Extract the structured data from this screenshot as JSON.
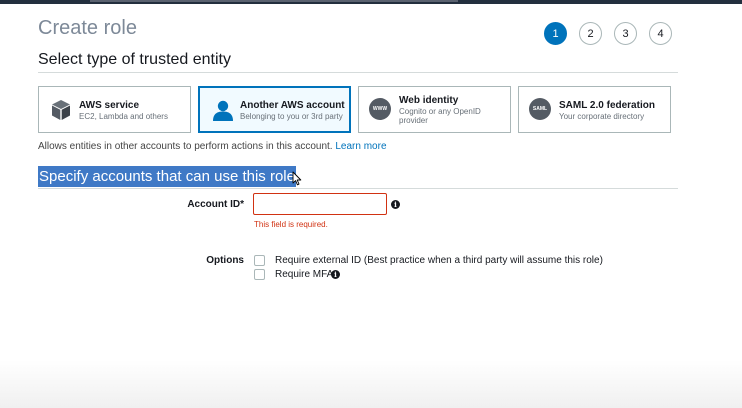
{
  "header": {
    "title": "Create role",
    "steps": [
      "1",
      "2",
      "3",
      "4"
    ],
    "active_step": 1
  },
  "trusted_entity": {
    "heading": "Select type of trusted entity",
    "options": [
      {
        "title": "AWS service",
        "subtitle": "EC2, Lambda and others",
        "icon": "aws-service-cube-icon",
        "selected": false
      },
      {
        "title": "Another AWS account",
        "subtitle": "Belonging to you or 3rd party",
        "icon": "user-account-icon",
        "selected": true
      },
      {
        "title": "Web identity",
        "subtitle": "Cognito or any OpenID provider",
        "icon": "web-identity-icon",
        "icon_text": "WWW",
        "selected": false
      },
      {
        "title": "SAML 2.0 federation",
        "subtitle": "Your corporate directory",
        "icon": "saml-federation-icon",
        "icon_text": "SAML",
        "selected": false
      }
    ],
    "help_text": "Allows entities in other accounts to perform actions in this account.",
    "learn_more": "Learn more"
  },
  "accounts": {
    "heading": "Specify accounts that can use this role",
    "account_id_label": "Account ID*",
    "account_id_value": "",
    "error": "This field is required.",
    "options_label": "Options",
    "options": [
      {
        "label": "Require external ID (Best practice when a third party will assume this role)",
        "checked": false
      },
      {
        "label": "Require MFA",
        "checked": false
      }
    ]
  },
  "colors": {
    "primary": "#0073bb",
    "error": "#d13212",
    "selection_highlight": "#3f79c6",
    "icon_gray": "#545b64"
  }
}
